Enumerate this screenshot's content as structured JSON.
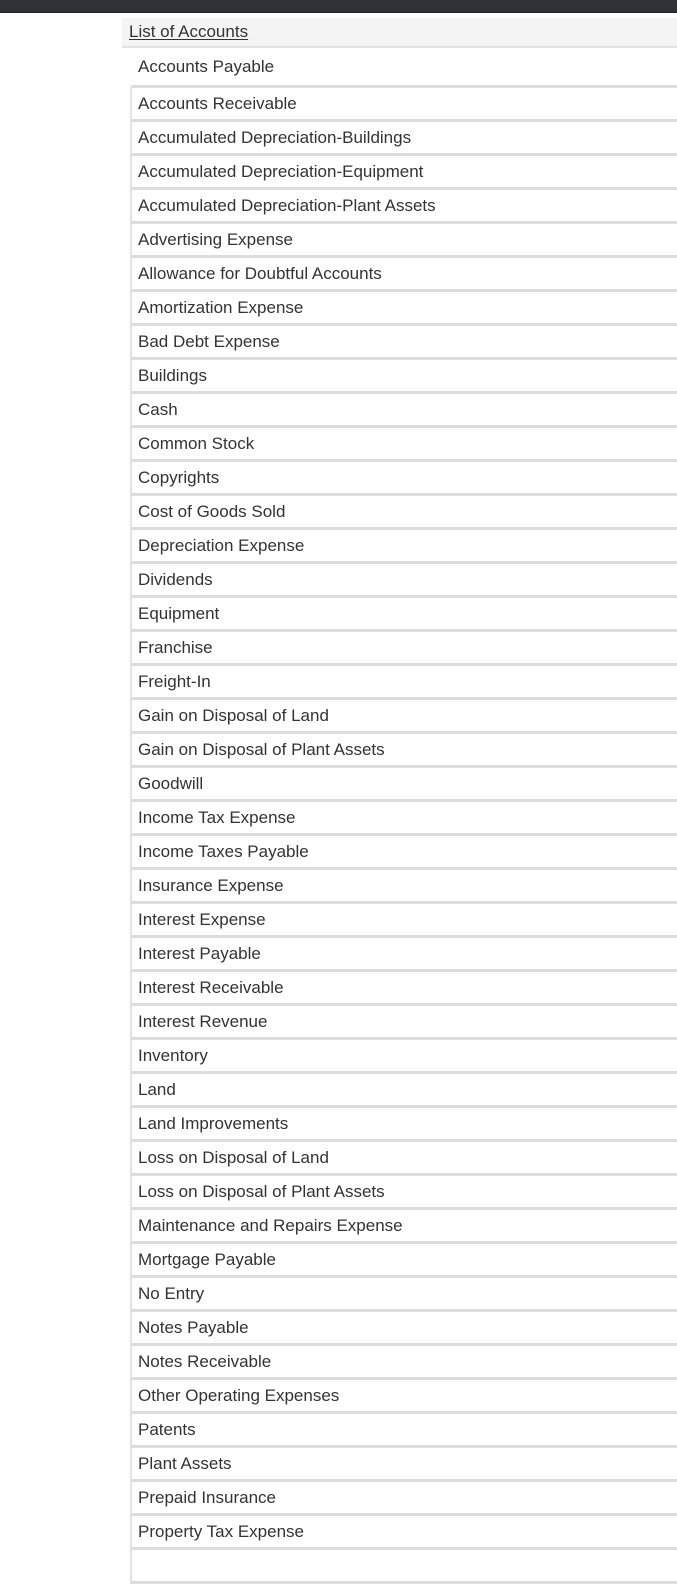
{
  "header": {
    "title": "List of Accounts"
  },
  "accounts": [
    "Accounts Payable",
    "Accounts Receivable",
    "Accumulated Depreciation-Buildings",
    "Accumulated Depreciation-Equipment",
    "Accumulated Depreciation-Plant Assets",
    "Advertising Expense",
    "Allowance for Doubtful Accounts",
    "Amortization Expense",
    "Bad Debt Expense",
    "Buildings",
    "Cash",
    "Common Stock",
    "Copyrights",
    "Cost of Goods Sold",
    "Depreciation Expense",
    "Dividends",
    "Equipment",
    "Franchise",
    "Freight-In",
    "Gain on Disposal of Land",
    "Gain on Disposal of Plant Assets",
    "Goodwill",
    "Income Tax Expense",
    "Income Taxes Payable",
    "Insurance Expense",
    "Interest Expense",
    "Interest Payable",
    "Interest Receivable",
    "Interest Revenue",
    "Inventory",
    "Land",
    "Land Improvements",
    "Loss on Disposal of Land",
    "Loss on Disposal of Plant Assets",
    "Maintenance and Repairs Expense",
    "Mortgage Payable",
    "No Entry",
    "Notes Payable",
    "Notes Receivable",
    "Other Operating Expenses",
    "Patents",
    "Plant Assets",
    "Prepaid Insurance",
    "Property Tax Expense",
    ""
  ]
}
